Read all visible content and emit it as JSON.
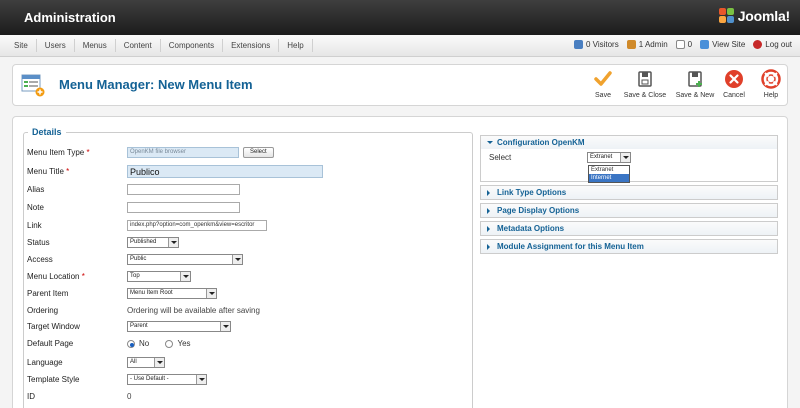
{
  "header": {
    "title": "Administration",
    "logo_text": "Joomla!"
  },
  "menu": [
    "Site",
    "Users",
    "Menus",
    "Content",
    "Components",
    "Extensions",
    "Help"
  ],
  "status": [
    {
      "label": "0 Visitors",
      "icon": "visitors-icon",
      "color": "#4a7fc1"
    },
    {
      "label": "1 Admin",
      "icon": "admin-icon",
      "color": "#d08a2a"
    },
    {
      "label": "0",
      "icon": "messages-icon",
      "color": "#888888"
    },
    {
      "label": "View Site",
      "icon": "view-site-icon",
      "color": "#4a90d9"
    },
    {
      "label": "Log out",
      "icon": "logout-icon",
      "color": "#c62828"
    }
  ],
  "toolbar": {
    "page_title": "Menu Manager: New Menu Item",
    "buttons": [
      {
        "label": "Save",
        "icon": "save-check-icon",
        "color": "#f0a22e"
      },
      {
        "label": "Save & Close",
        "icon": "save-close-icon",
        "color": "#555555"
      },
      {
        "label": "Save & New",
        "icon": "save-new-icon",
        "color": "#555555"
      },
      {
        "label": "Cancel",
        "icon": "cancel-icon",
        "color": "#e0402a"
      },
      {
        "label": "Help",
        "icon": "help-icon",
        "color": "#e0402a"
      }
    ]
  },
  "details": {
    "legend": "Details",
    "menu_item_type": {
      "label": "Menu Item Type",
      "value": "OpenKM file browser",
      "button": "Select"
    },
    "menu_title": {
      "label": "Menu Title",
      "value": "Publico"
    },
    "alias": {
      "label": "Alias",
      "value": ""
    },
    "note": {
      "label": "Note",
      "value": ""
    },
    "link": {
      "label": "Link",
      "value": "index.php?option=com_openkm&view=escritor"
    },
    "status": {
      "label": "Status",
      "value": "Published"
    },
    "access": {
      "label": "Access",
      "value": "Public"
    },
    "menu_location": {
      "label": "Menu Location",
      "value": "Top"
    },
    "parent_item": {
      "label": "Parent Item",
      "value": "Menu Item Root"
    },
    "ordering": {
      "label": "Ordering",
      "value": "Ordering will be available after saving"
    },
    "target_window": {
      "label": "Target Window",
      "value": "Parent"
    },
    "default_page": {
      "label": "Default Page",
      "no": "No",
      "yes": "Yes",
      "selected": "No"
    },
    "language": {
      "label": "Language",
      "value": "All"
    },
    "template_style": {
      "label": "Template Style",
      "value": "- Use Default -"
    },
    "id": {
      "label": "ID",
      "value": "0"
    }
  },
  "panels": {
    "config": {
      "title": "Configuration OpenKM",
      "select_label": "Select",
      "select_value": "Extranet",
      "options": [
        "Extranet",
        "Internet"
      ],
      "highlighted": "Internet"
    },
    "collapsed": [
      "Link Type Options",
      "Page Display Options",
      "Metadata Options",
      "Module Assignment for this Menu Item"
    ]
  },
  "colors": {
    "accent": "#146295",
    "header_bg": "#2a2a2a",
    "required": "#cc0000"
  }
}
